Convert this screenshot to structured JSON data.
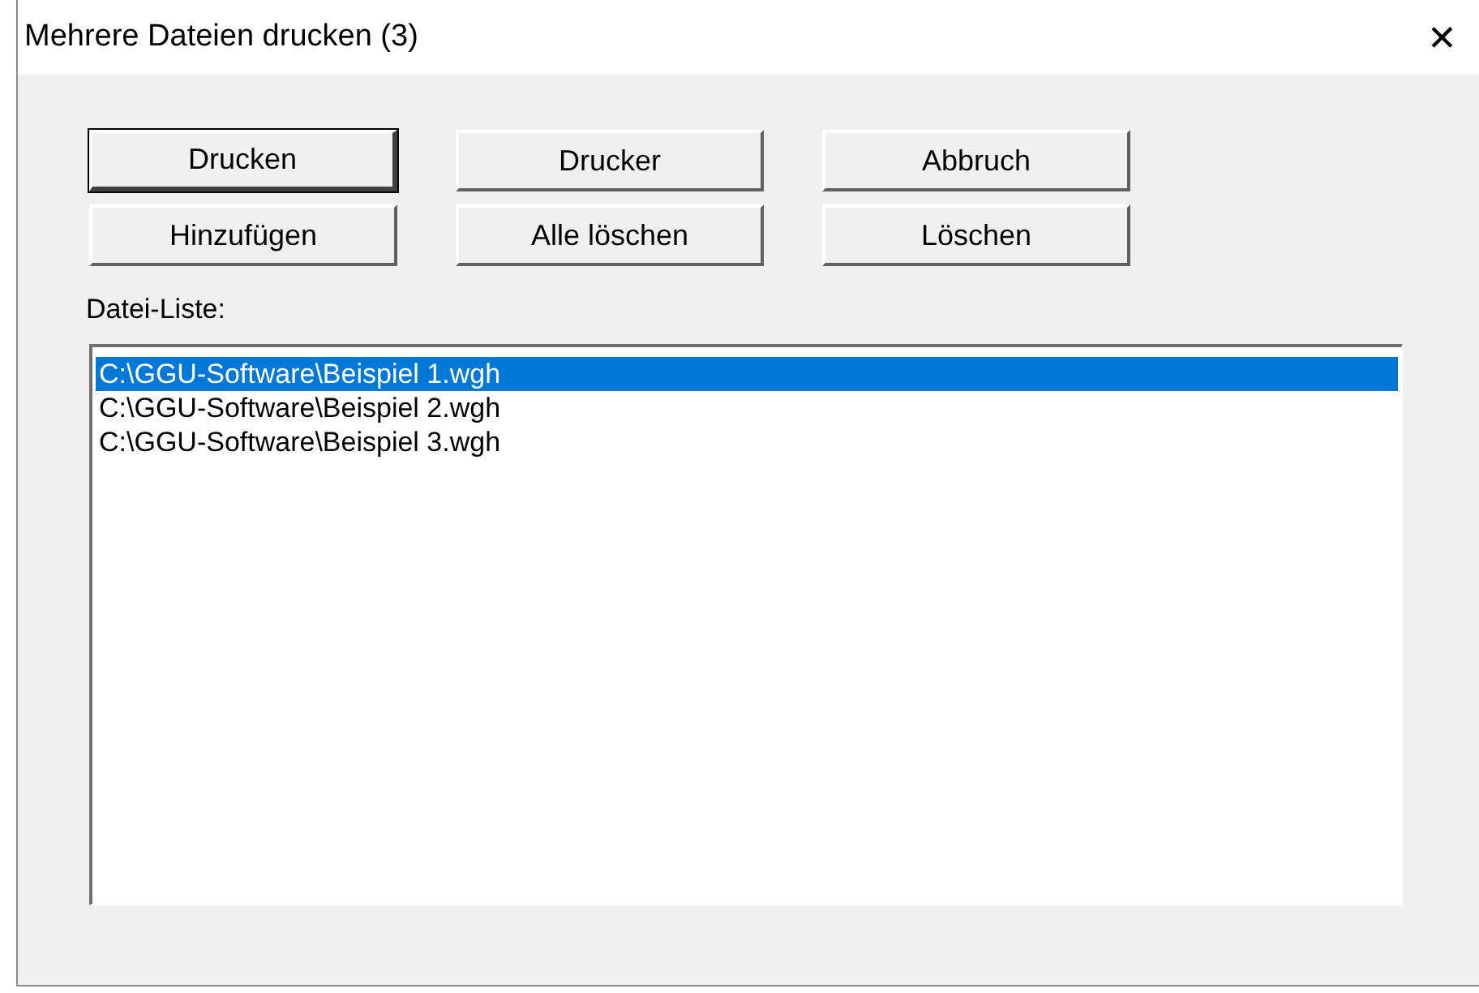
{
  "window": {
    "title": "Mehrere Dateien drucken (3)",
    "close": "✕"
  },
  "buttons": [
    {
      "label": "Drucken",
      "default": true
    },
    {
      "label": "Drucker",
      "default": false
    },
    {
      "label": "Abbruch",
      "default": false
    },
    {
      "label": "Hinzufügen",
      "default": false
    },
    {
      "label": "Alle löschen",
      "default": false
    },
    {
      "label": "Löschen",
      "default": false
    }
  ],
  "file_list": {
    "label": "Datei-Liste:",
    "items": [
      {
        "text": "C:\\GGU-Software\\Beispiel 1.wgh",
        "selected": true
      },
      {
        "text": "C:\\GGU-Software\\Beispiel 2.wgh",
        "selected": false
      },
      {
        "text": "C:\\GGU-Software\\Beispiel 3.wgh",
        "selected": false
      }
    ]
  }
}
